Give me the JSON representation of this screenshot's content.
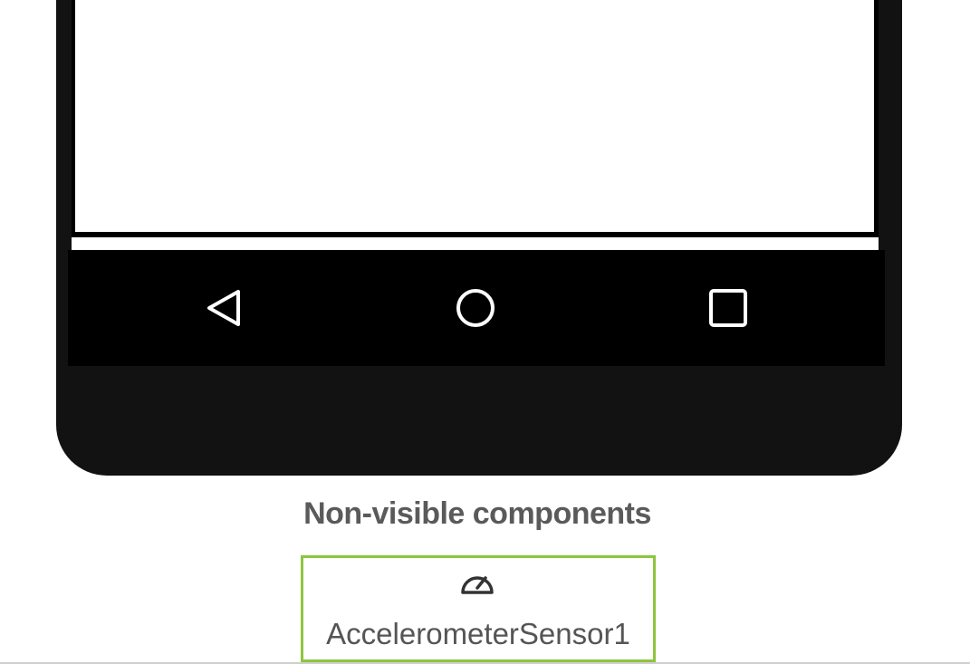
{
  "device": {
    "nav_buttons": [
      "back",
      "home",
      "recent-apps"
    ]
  },
  "nonvisible": {
    "title": "Non-visible components",
    "components": [
      {
        "name": "AccelerometerSensor1",
        "icon": "speedometer-icon",
        "selected": true
      }
    ]
  },
  "colors": {
    "selected_border": "#8dc53e",
    "phone_bezel": "#121212",
    "nav_bar": "#000000"
  }
}
